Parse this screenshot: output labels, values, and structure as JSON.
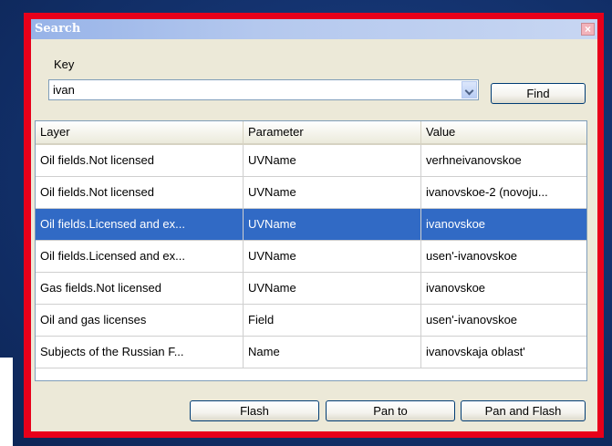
{
  "window": {
    "title": "Search"
  },
  "search": {
    "key_label": "Key",
    "value": "ivan",
    "find_label": "Find"
  },
  "table": {
    "headers": [
      "Layer",
      "Parameter",
      "Value"
    ],
    "rows": [
      {
        "layer": "Oil fields.Not licensed",
        "parameter": "UVName",
        "value": "verhneivanovskoe"
      },
      {
        "layer": "Oil fields.Not licensed",
        "parameter": "UVName",
        "value": "ivanovskoe-2 (novoju..."
      },
      {
        "layer": "Oil fields.Licensed and ex...",
        "parameter": "UVName",
        "value": "ivanovskoe"
      },
      {
        "layer": "Oil fields.Licensed and ex...",
        "parameter": "UVName",
        "value": "usen'-ivanovskoe"
      },
      {
        "layer": "Gas fields.Not licensed",
        "parameter": "UVName",
        "value": "ivanovskoe"
      },
      {
        "layer": "Oil and gas licenses",
        "parameter": "Field",
        "value": "usen'-ivanovskoe"
      },
      {
        "layer": "Subjects of the Russian F...",
        "parameter": "Name",
        "value": "ivanovskaja oblast'"
      }
    ],
    "selected_row": 3
  },
  "actions": {
    "flash": "Flash",
    "pan_to": "Pan to",
    "pan_and_flash": "Pan and Flash"
  },
  "icons": {
    "close": "close-icon",
    "dropdown": "chevron-down-icon"
  },
  "colors": {
    "frame": "#e8001a",
    "selection": "#316ac5",
    "background": "#12306a"
  }
}
